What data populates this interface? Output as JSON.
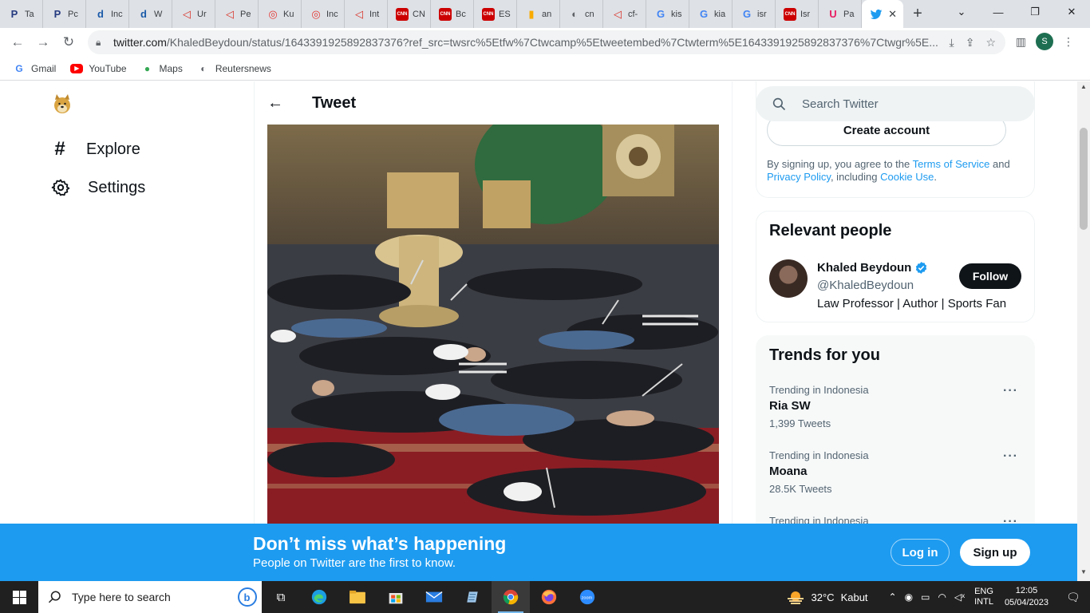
{
  "browser": {
    "tabs": [
      {
        "label": "Ta",
        "icon": "paypal-icon",
        "color": "#253b80",
        "glyph": "P"
      },
      {
        "label": "Pc",
        "icon": "paypal-icon",
        "color": "#253b80",
        "glyph": "P"
      },
      {
        "label": "Inc",
        "icon": "detik-icon",
        "color": "#1a5aa8",
        "glyph": "d"
      },
      {
        "label": "W",
        "icon": "detik-icon",
        "color": "#1a5aa8",
        "glyph": "d"
      },
      {
        "label": "Ur",
        "icon": "red-arrow-icon",
        "color": "#d93025",
        "glyph": "◁"
      },
      {
        "label": "Pe",
        "icon": "red-arrow-icon",
        "color": "#d93025",
        "glyph": "◁"
      },
      {
        "label": "Ku",
        "icon": "target-icon",
        "color": "#e53935",
        "glyph": "◎"
      },
      {
        "label": "Inc",
        "icon": "target-icon",
        "color": "#e53935",
        "glyph": "◎"
      },
      {
        "label": "Int",
        "icon": "red-arrow-icon",
        "color": "#d93025",
        "glyph": "◁"
      },
      {
        "label": "CN",
        "icon": "cnn-icon",
        "color": "#cc0000",
        "glyph": "CNN"
      },
      {
        "label": "Bc",
        "icon": "cnn-icon",
        "color": "#cc0000",
        "glyph": "CNN"
      },
      {
        "label": "ES",
        "icon": "cnn-icon",
        "color": "#cc0000",
        "glyph": "CNN"
      },
      {
        "label": "an",
        "icon": "analytics-icon",
        "color": "#f9ab00",
        "glyph": "▮"
      },
      {
        "label": "cn",
        "icon": "globe-icon",
        "color": "#5f6368",
        "glyph": "◐"
      },
      {
        "label": "cf-",
        "icon": "red-arrow-icon",
        "color": "#d93025",
        "glyph": "◁"
      },
      {
        "label": "kis",
        "icon": "google-icon",
        "color": "#4285f4",
        "glyph": "G"
      },
      {
        "label": "kia",
        "icon": "google-icon",
        "color": "#4285f4",
        "glyph": "G"
      },
      {
        "label": "isr",
        "icon": "google-icon",
        "color": "#4285f4",
        "glyph": "G"
      },
      {
        "label": "Isr",
        "icon": "cnn-icon",
        "color": "#cc0000",
        "glyph": "CNN"
      },
      {
        "label": "Pa",
        "icon": "u-icon",
        "color": "#e91e63",
        "glyph": "U"
      }
    ],
    "url_host": "twitter.com",
    "url_path": "/KhaledBeydoun/status/1643391925892837376?ref_src=twsrc%5Etfw%7Ctwcamp%5Etweetembed%7Ctwterm%5E1643391925892837376%7Ctwgr%5E...",
    "profile_initial": "S",
    "bookmarks": [
      {
        "label": "Gmail",
        "icon": "google-icon"
      },
      {
        "label": "YouTube",
        "icon": "youtube-icon"
      },
      {
        "label": "Maps",
        "icon": "maps-icon"
      },
      {
        "label": "Reutersnews",
        "icon": "globe-icon"
      }
    ]
  },
  "nav": {
    "explore": "Explore",
    "settings": "Settings"
  },
  "tweet": {
    "header_title": "Tweet"
  },
  "sidebar": {
    "search_placeholder": "Search Twitter",
    "create_account": "Create account",
    "legal_prefix": "By signing up, you agree to the ",
    "terms": "Terms of Service",
    "and": " and ",
    "privacy": "Privacy Policy",
    "including": ", including ",
    "cookie": "Cookie Use",
    "period": "."
  },
  "relevant": {
    "title": "Relevant people",
    "name": "Khaled Beydoun",
    "handle": "@KhaledBeydoun",
    "bio": "Law Professor | Author | Sports Fan",
    "follow": "Follow"
  },
  "trends": {
    "title": "Trends for you",
    "items": [
      {
        "context": "Trending in Indonesia",
        "name": "Ria SW",
        "count": "1,399 Tweets"
      },
      {
        "context": "Trending in Indonesia",
        "name": "Moana",
        "count": "28.5K Tweets"
      },
      {
        "context": "Trending in Indonesia",
        "name": "",
        "count": ""
      }
    ]
  },
  "banner": {
    "title": "Don’t miss what’s happening",
    "subtitle": "People on Twitter are the first to know.",
    "login": "Log in",
    "signup": "Sign up"
  },
  "taskbar": {
    "search_placeholder": "Type here to search",
    "weather_temp": "32°C",
    "weather_desc": "Kabut",
    "lang_top": "ENG",
    "lang_bottom": "INTL",
    "time": "12:05",
    "date": "05/04/2023"
  },
  "colors": {
    "twitter_blue": "#1d9bf0",
    "verified_blue": "#1d9bf0"
  }
}
